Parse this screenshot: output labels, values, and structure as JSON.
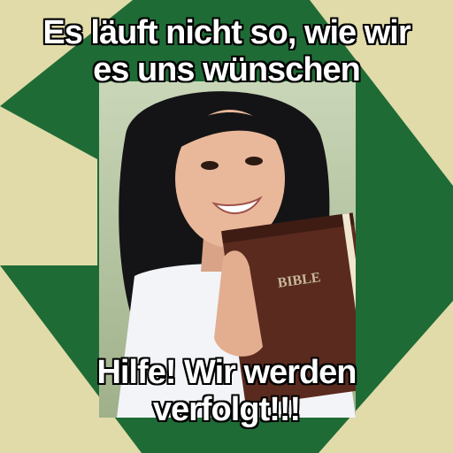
{
  "meme": {
    "top_lines": [
      "Es läuft nicht so, wie wir",
      "es uns wünschen"
    ],
    "bottom_lines": [
      "Hilfe! Wir werden",
      "verfolgt!!!"
    ],
    "book_label": "BIBLE"
  },
  "colors": {
    "green": "#1f6b36",
    "cream": "#e1dba9",
    "book": "#5a2a1e",
    "hair": "#141416",
    "skin": "#e9b89a",
    "shirt": "#f2f4f8"
  },
  "icons": {
    "portrait": "smiling-woman-holding-book"
  }
}
